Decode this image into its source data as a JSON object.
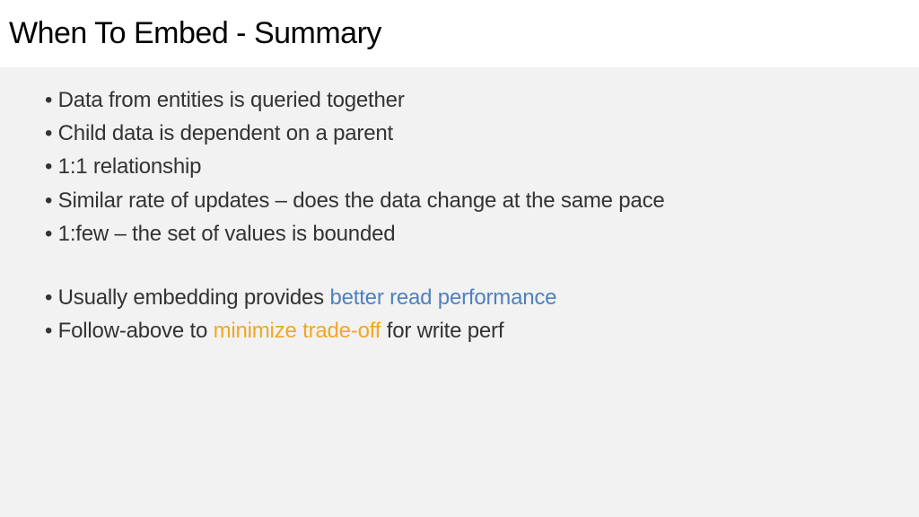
{
  "title": "When To Embed - Summary",
  "bullets": {
    "b1": "Data from entities is queried together",
    "b2": "Child data is dependent on a parent",
    "b3": "1:1 relationship",
    "b4": "Similar rate of updates – does the data change at the same pace",
    "b5": "1:few – the set of values is bounded",
    "b6_pre": "Usually embedding provides ",
    "b6_hl": "better read performance",
    "b7_pre": "Follow-above to ",
    "b7_hl": "minimize trade-off",
    "b7_post": " for write perf"
  }
}
